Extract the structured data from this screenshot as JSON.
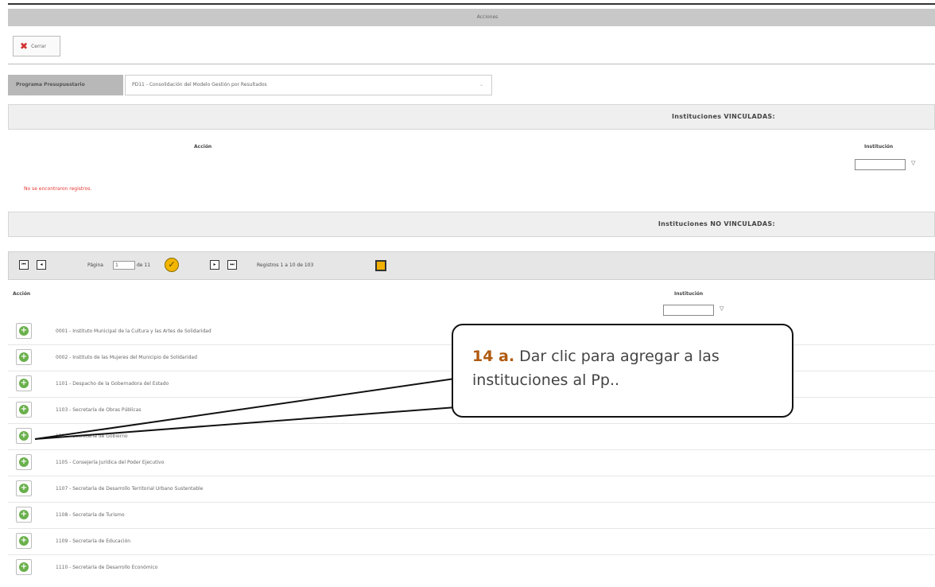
{
  "window": {
    "title": "Acciones"
  },
  "toolbar": {
    "close_label": "Cerrar"
  },
  "programa": {
    "label": "Programa Presupuestario",
    "value": "PD11 - Consolidación del Modelo Gestión por Resultados"
  },
  "vinculadas": {
    "title": "Instituciones VINCULADAS:",
    "col_accion": "Acción",
    "col_institucion": "Institución",
    "empty_message": "No se encontraron registros.",
    "filter_symbol": "▽"
  },
  "no_vinculadas": {
    "title": "Instituciones NO VINCULADAS:",
    "col_accion": "Acción",
    "col_institucion": "Institución",
    "filter_symbol": "▽",
    "pager": {
      "page_label": "Página",
      "page_value": "1",
      "of_label": "de 11",
      "records_label": "Registros 1 a 10 de 103"
    },
    "rows": [
      {
        "label": "0001 - Instituto Municipal de la Cultura y las Artes de Solidaridad"
      },
      {
        "label": "0002 - Instituto de las Mujeres del Municipio de Solidaridad"
      },
      {
        "label": "1101 - Despacho de la Gobernadora del Estado"
      },
      {
        "label": "1103 - Secretaría de Obras Públicas"
      },
      {
        "label": "1104 - Secretaría de Gobierno"
      },
      {
        "label": "1105 - Consejería Jurídica del Poder Ejecutivo"
      },
      {
        "label": "1107 - Secretaría de Desarrollo Territorial Urbano Sustentable"
      },
      {
        "label": "1108 - Secretaría de Turismo"
      },
      {
        "label": "1109 - Secretaría de Educación"
      },
      {
        "label": "1110 - Secretaría de Desarrollo Económico"
      }
    ]
  },
  "callout": {
    "step": "14 a.",
    "text": "Dar clic para agregar a las instituciones al Pp.."
  },
  "colors": {
    "accent_step": "#b05a10",
    "error": "#e53935",
    "add_green": "#6ab04c"
  }
}
